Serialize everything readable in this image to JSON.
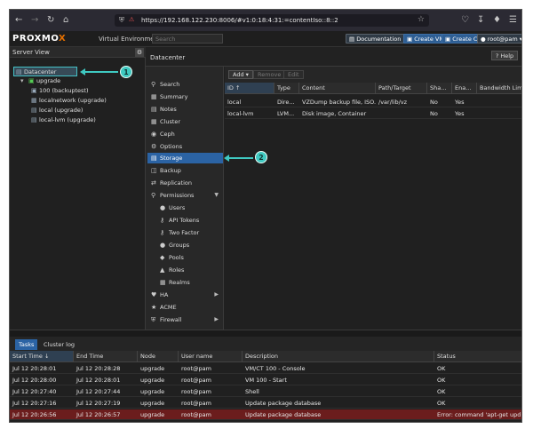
{
  "browser": {
    "url": "https://192.168.122.230:8006/#v1:0:18:4:31:=contentIso::8::2",
    "icons": [
      "back-icon",
      "forward-icon",
      "reload-icon",
      "home-icon",
      "shield-icon",
      "lock-icon",
      "star-icon",
      "pocket-icon",
      "download-icon",
      "extensions-icon",
      "menu-icon"
    ]
  },
  "header": {
    "logo_main": "PROXMO",
    "logo_x": "X",
    "version": "Virtual Environment 8.0.3",
    "search_placeholder": "Search",
    "documentation": "Documentation",
    "create_vm": "Create VM",
    "create_ct": "Create CT",
    "user": "root@pam"
  },
  "tree": {
    "view_label": "Server View",
    "datacenter": "Datacenter",
    "node": "upgrade",
    "vm": "100 (backuptest)",
    "network": "localnetwork (upgrade)",
    "local": "local (upgrade)",
    "local_lvm": "local-lvm (upgrade)"
  },
  "panel": {
    "title": "Datacenter",
    "help": "Help"
  },
  "nav": [
    {
      "label": "Search",
      "icon": "search-icon"
    },
    {
      "label": "Summary",
      "icon": "summary-icon"
    },
    {
      "label": "Notes",
      "icon": "notes-icon"
    },
    {
      "label": "Cluster",
      "icon": "cluster-icon"
    },
    {
      "label": "Ceph",
      "icon": "ceph-icon"
    },
    {
      "label": "Options",
      "icon": "gear-icon"
    },
    {
      "label": "Storage",
      "icon": "database-icon"
    },
    {
      "label": "Backup",
      "icon": "backup-icon"
    },
    {
      "label": "Replication",
      "icon": "replication-icon"
    },
    {
      "label": "Permissions",
      "icon": "unlock-icon"
    },
    {
      "label": "Users",
      "icon": "user-icon"
    },
    {
      "label": "API Tokens",
      "icon": "key-icon"
    },
    {
      "label": "Two Factor",
      "icon": "key-icon"
    },
    {
      "label": "Groups",
      "icon": "users-icon"
    },
    {
      "label": "Pools",
      "icon": "tags-icon"
    },
    {
      "label": "Roles",
      "icon": "male-icon"
    },
    {
      "label": "Realms",
      "icon": "building-icon"
    },
    {
      "label": "HA",
      "icon": "heartbeat-icon"
    },
    {
      "label": "ACME",
      "icon": "certificate-icon"
    },
    {
      "label": "Firewall",
      "icon": "shield-icon"
    }
  ],
  "toolbar": {
    "add": "Add",
    "remove": "Remove",
    "edit": "Edit"
  },
  "storage_table": {
    "columns": [
      "ID",
      "Type",
      "Content",
      "Path/Target",
      "Sha...",
      "Ena...",
      "Bandwidth Limit"
    ],
    "rows": [
      [
        "local",
        "Dire...",
        "VZDump backup file, ISO...",
        "/var/lib/vz",
        "No",
        "Yes",
        ""
      ],
      [
        "local-lvm",
        "LVM...",
        "Disk image, Container",
        "",
        "No",
        "Yes",
        ""
      ]
    ]
  },
  "tasks": {
    "tab_tasks": "Tasks",
    "tab_cluster": "Cluster log",
    "columns": [
      "Start Time",
      "End Time",
      "Node",
      "User name",
      "Description",
      "Status"
    ],
    "rows": [
      [
        "Jul 12 20:28:01",
        "Jul 12 20:28:28",
        "upgrade",
        "root@pam",
        "VM/CT 100 - Console",
        "OK"
      ],
      [
        "Jul 12 20:28:00",
        "Jul 12 20:28:01",
        "upgrade",
        "root@pam",
        "VM 100 - Start",
        "OK"
      ],
      [
        "Jul 12 20:27:40",
        "Jul 12 20:27:44",
        "upgrade",
        "root@pam",
        "Shell",
        "OK"
      ],
      [
        "Jul 12 20:27:16",
        "Jul 12 20:27:19",
        "upgrade",
        "root@pam",
        "Update package database",
        "OK"
      ],
      [
        "Jul 12 20:26:56",
        "Jul 12 20:26:57",
        "upgrade",
        "root@pam",
        "Update package database",
        "Error: command 'apt-get upd..."
      ]
    ]
  },
  "callouts": [
    "1",
    "2"
  ],
  "colors": {
    "accent": "#2b63a4",
    "callout": "#3fc9c1",
    "error_row": "#6b1d1d",
    "logo_x": "#e57000"
  }
}
